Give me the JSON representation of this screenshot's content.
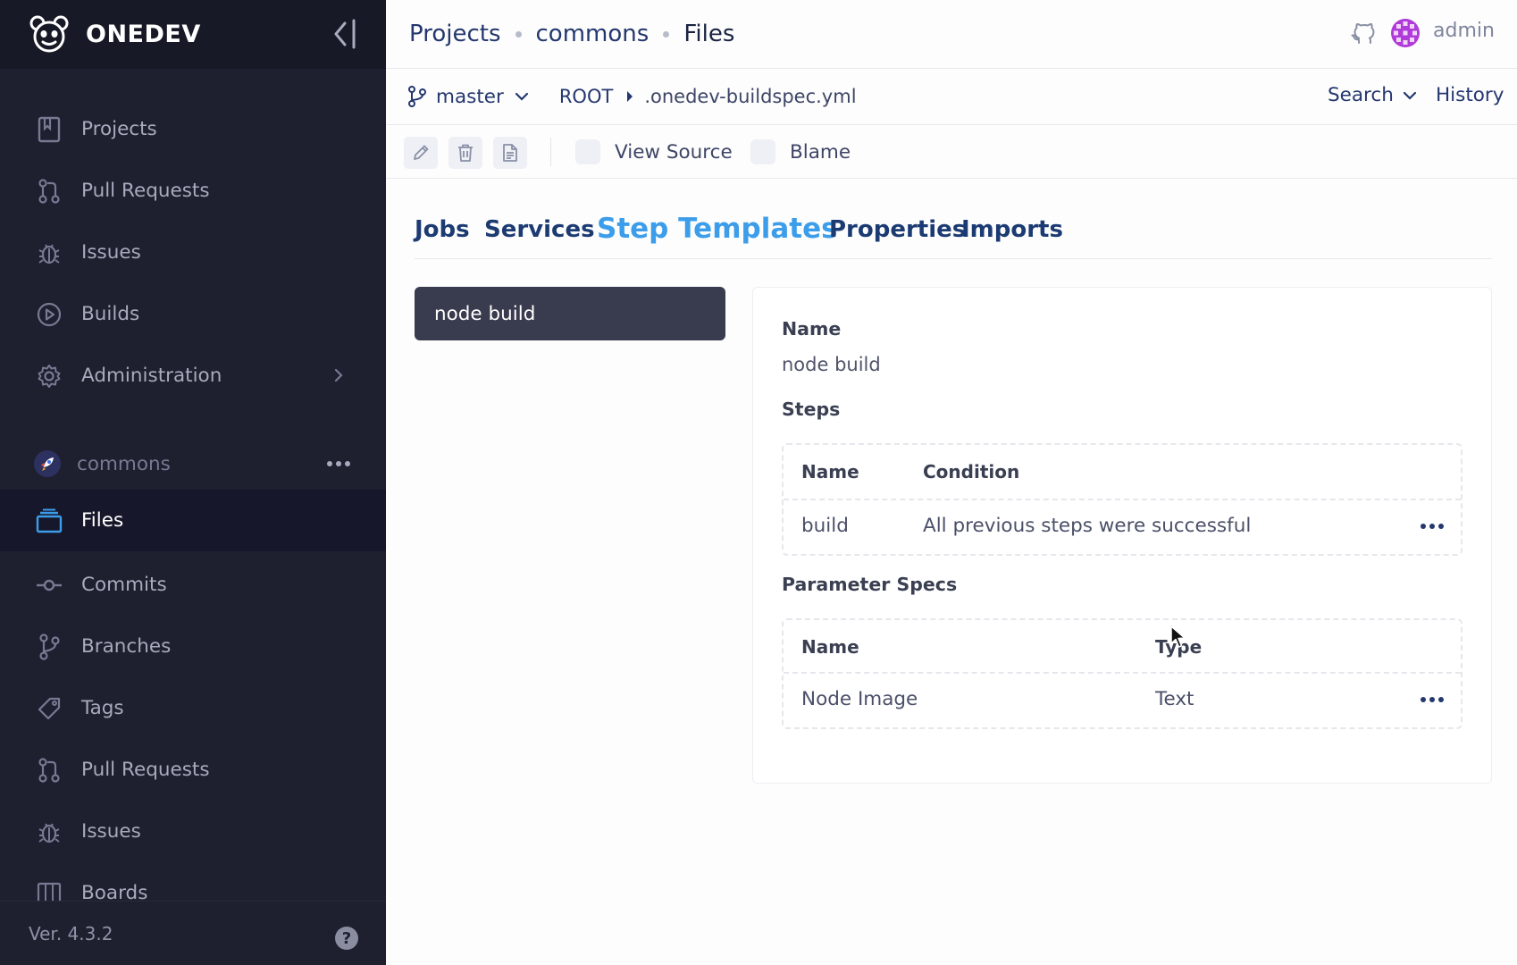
{
  "app": {
    "brand": "ONEDEV",
    "version": "Ver. 4.3.2"
  },
  "sidebar": {
    "global_items": [
      {
        "label": "Projects",
        "icon": "projects-icon"
      },
      {
        "label": "Pull Requests",
        "icon": "pull-request-icon"
      },
      {
        "label": "Issues",
        "icon": "bug-icon"
      },
      {
        "label": "Builds",
        "icon": "play-icon"
      },
      {
        "label": "Administration",
        "icon": "gear-icon"
      }
    ],
    "project": {
      "name": "commons"
    },
    "project_items": [
      {
        "label": "Files",
        "icon": "files-icon",
        "active": true
      },
      {
        "label": "Commits",
        "icon": "commit-icon"
      },
      {
        "label": "Branches",
        "icon": "branch-icon"
      },
      {
        "label": "Tags",
        "icon": "tag-icon"
      },
      {
        "label": "Pull Requests",
        "icon": "pull-request-icon"
      },
      {
        "label": "Issues",
        "icon": "bug-icon"
      },
      {
        "label": "Boards",
        "icon": "board-icon"
      }
    ]
  },
  "header": {
    "breadcrumbs": [
      "Projects",
      "commons",
      "Files"
    ],
    "user": "admin"
  },
  "filebar": {
    "branch": "master",
    "path_root": "ROOT",
    "path_file": ".onedev-buildspec.yml",
    "search_label": "Search",
    "history_label": "History"
  },
  "toolbar": {
    "view_source_label": "View Source",
    "blame_label": "Blame"
  },
  "tabs": [
    {
      "label": "Jobs"
    },
    {
      "label": "Services"
    },
    {
      "label": "Step Templates",
      "active": true
    },
    {
      "label": "Properties"
    },
    {
      "label": "Imports"
    }
  ],
  "templates": [
    "node build"
  ],
  "detail": {
    "name_label": "Name",
    "name_value": "node build",
    "steps_label": "Steps",
    "steps_columns": [
      "Name",
      "Condition"
    ],
    "steps_rows": [
      {
        "name": "build",
        "condition": "All previous steps were successful"
      }
    ],
    "params_label": "Parameter Specs",
    "params_columns": [
      "Name",
      "Type"
    ],
    "params_rows": [
      {
        "name": "Node Image",
        "type": "Text"
      }
    ]
  },
  "colors": {
    "sidebar_bg": "#1e1f2f",
    "link": "#24376f",
    "active_tab": "#3c9dea",
    "template_item_bg": "#393b4e"
  }
}
